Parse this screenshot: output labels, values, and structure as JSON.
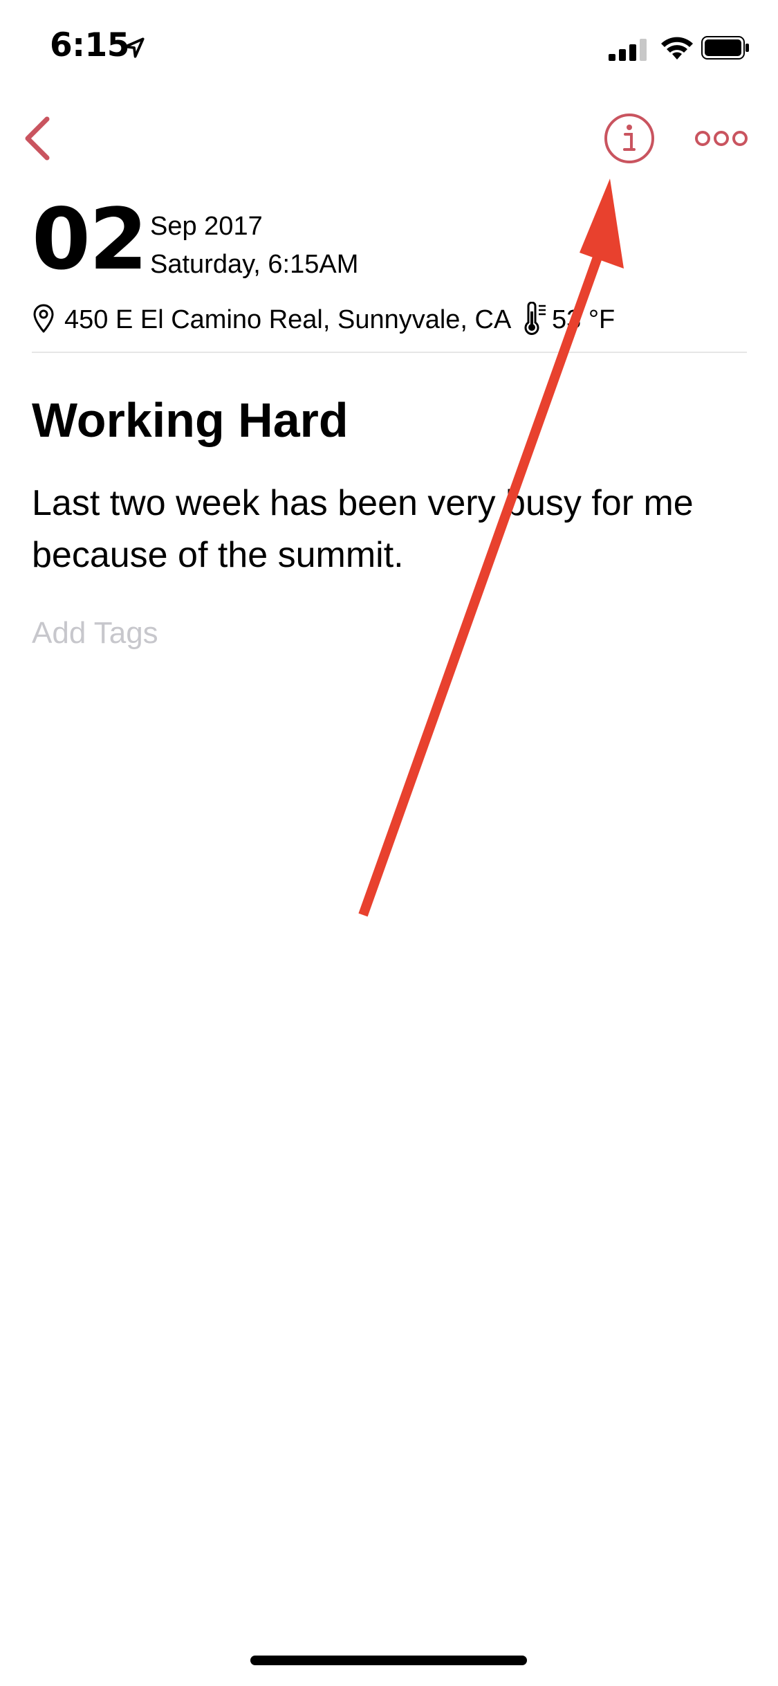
{
  "status_bar": {
    "time": "6:15",
    "icons": [
      "location-arrow-icon",
      "cellular-signal-icon",
      "wifi-icon",
      "battery-icon"
    ]
  },
  "nav": {
    "back_icon": "chevron-left-icon",
    "info_icon": "info-circle-icon",
    "more_icon": "more-dots-icon",
    "accent_color": "#c9545f"
  },
  "entry": {
    "day": "02",
    "month_year": "Sep 2017",
    "weekday_time": "Saturday, 6:15AM",
    "location": "450 E El Camino Real, Sunnyvale, CA",
    "temperature": "53 °F",
    "title": "Working Hard",
    "body": "Last two week has been very busy for me because of the summit.",
    "tags_placeholder": "Add Tags"
  },
  "annotation": {
    "type": "arrow",
    "color": "#e8412e",
    "points_to": "info-button"
  }
}
